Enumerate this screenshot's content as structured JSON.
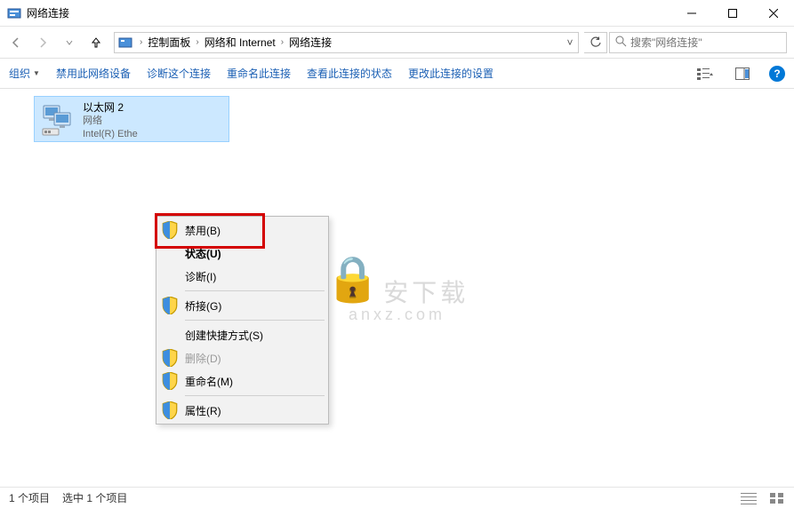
{
  "titlebar": {
    "title": "网络连接"
  },
  "breadcrumb": {
    "items": [
      "控制面板",
      "网络和 Internet",
      "网络连接"
    ]
  },
  "search": {
    "placeholder": "搜索\"网络连接\""
  },
  "toolbar": {
    "organize": "组织",
    "disable": "禁用此网络设备",
    "diagnose": "诊断这个连接",
    "rename": "重命名此连接",
    "viewStatus": "查看此连接的状态",
    "changeSettings": "更改此连接的设置"
  },
  "network_item": {
    "name": "以太网 2",
    "status": "网络",
    "device": "Intel(R) Ethe"
  },
  "context_menu": {
    "disable": "禁用(B)",
    "status": "状态(U)",
    "diagnose": "诊断(I)",
    "bridge": "桥接(G)",
    "shortcut": "创建快捷方式(S)",
    "delete": "删除(D)",
    "rename": "重命名(M)",
    "properties": "属性(R)"
  },
  "statusbar": {
    "count": "1 个项目",
    "selected": "选中 1 个项目"
  },
  "watermark": {
    "text": "安下载",
    "url": "anxz.com"
  }
}
